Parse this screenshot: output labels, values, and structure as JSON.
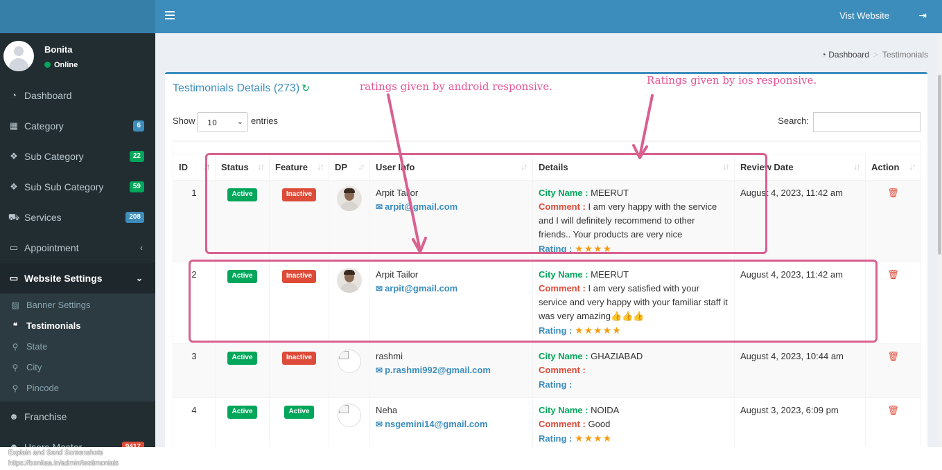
{
  "topbar": {
    "visit_label": "Vist Website"
  },
  "user": {
    "name": "Bonita",
    "status": "Online"
  },
  "sidebar": {
    "items": [
      {
        "label": "Dashboard",
        "icon": "dashboard-icon"
      },
      {
        "label": "Category",
        "badge": "6",
        "badge_color": "#3c8dbc"
      },
      {
        "label": "Sub Category",
        "badge": "22",
        "badge_color": "#00a65a"
      },
      {
        "label": "Sub Sub Category",
        "badge": "59",
        "badge_color": "#00a65a"
      },
      {
        "label": "Services",
        "badge": "208",
        "badge_color": "#3c8dbc"
      },
      {
        "label": "Appointment"
      },
      {
        "label": "Website Settings"
      },
      {
        "label": "Franchise"
      },
      {
        "label": "Users Master",
        "badge": "9417",
        "badge_color": "#dd4b39"
      }
    ],
    "submenu": [
      {
        "label": "Banner Settings"
      },
      {
        "label": "Testimonials"
      },
      {
        "label": "State"
      },
      {
        "label": "City"
      },
      {
        "label": "Pincode"
      }
    ]
  },
  "breadcrumb": {
    "home": "Dashboard",
    "current": "Testimonials"
  },
  "box": {
    "title": "Testimonials Details (273)"
  },
  "controls": {
    "show": "Show",
    "entries_value": "10",
    "entries": "entries",
    "search": "Search:"
  },
  "table": {
    "headers": [
      "ID",
      "Status",
      "Feature",
      "DP",
      "User Info",
      "Details",
      "Review Date",
      "Action"
    ],
    "labels": {
      "city": "City Name :",
      "comment": "Comment :",
      "rating": "Rating :"
    },
    "rows": [
      {
        "id": "1",
        "status": "Active",
        "feature": "Inactive",
        "name": "Arpit Tailor",
        "email": "arpit@gmail.com",
        "city": "MEERUT",
        "comment": "I am very happy with the service and I will definitely recommend to other friends.. Your products are very nice",
        "stars": "★★★★",
        "date": "August 4, 2023, 11:42 am"
      },
      {
        "id": "2",
        "status": "Active",
        "feature": "Inactive",
        "name": "Arpit Tailor",
        "email": "arpit@gmail.com",
        "city": "MEERUT",
        "comment": "I am very satisfied with your service and very happy with your familiar staff it was very amazing",
        "emoji": "👍👍👍",
        "stars": "★★★★★",
        "date": "August 4, 2023, 11:42 am"
      },
      {
        "id": "3",
        "status": "Active",
        "feature": "Inactive",
        "name": "rashmi",
        "email": "p.rashmi992@gmail.com",
        "city": "GHAZIABAD",
        "comment": "",
        "stars": "",
        "date": "August 4, 2023, 10:44 am"
      },
      {
        "id": "4",
        "status": "Active",
        "feature": "Active",
        "name": "Neha",
        "email": "nsgemini14@gmail.com",
        "city": "NOIDA",
        "comment": "Good",
        "stars": "★★★★",
        "date": "August 3, 2023, 6:09 pm"
      }
    ]
  },
  "annotations": {
    "android": "ratings given by android responsive.",
    "ios": "Ratings given by ios responsive."
  },
  "footer": {
    "line1": "Explain and Send Screenshots",
    "line2": "https://bonitaa.in/admin/testimonials"
  },
  "colors": {
    "topbar": "#3c8dbc",
    "sidebar": "#222d32",
    "annotation": "#e75494"
  }
}
